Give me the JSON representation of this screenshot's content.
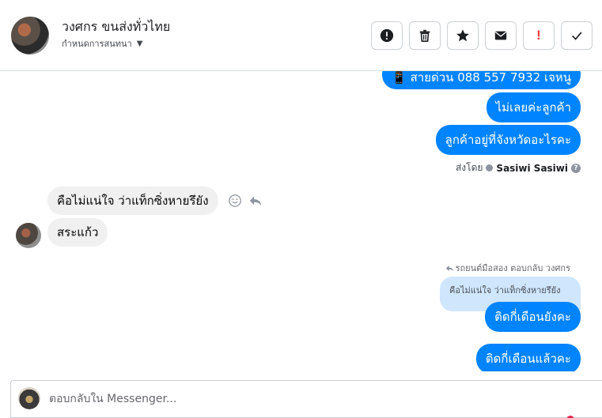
{
  "header": {
    "contact_name": "วงศกร ขนส่งทั่วไทย",
    "assign_label": "กำหนดการสนทนา",
    "toolbar": [
      {
        "name": "spam-alert",
        "icon": "exclamation-circle-icon"
      },
      {
        "name": "delete",
        "icon": "trash-icon"
      },
      {
        "name": "star",
        "icon": "star-icon"
      },
      {
        "name": "mark-unread",
        "icon": "envelope-icon"
      },
      {
        "name": "follow-up",
        "icon": "red-exclamation-icon",
        "label": "!"
      },
      {
        "name": "mark-done",
        "icon": "checkmark-icon"
      }
    ]
  },
  "messages": {
    "out_1": "📱 สายด่วน 088 557 7932 เจหนู",
    "out_2": "ไม่เลยค่ะลูกค้า",
    "out_3": "ลูกค้าอยู่ที่จังหวัดอะไรคะ",
    "sent_by_prefix": "ส่งโดย",
    "sent_by_name": "Sasiwi Sasiwi",
    "sent_by_help": "?",
    "in_1": "คือไม่แน่ใจ ว่าแท็กซิ่งหายรึยัง",
    "in_2": "สระแก้ว",
    "reply_note": "รถยนต์มือสอง ตอบกลับ วงศกร",
    "reply_quote": "คือไม่แน่ใจ ว่าแท็กซิ่งหายรึยัง",
    "out_4": "ติดกี่เดือนยังคะ",
    "out_5": "ติดกี่เดือนแล้วคะ"
  },
  "composer": {
    "placeholder": "ตอบกลับใน Messenger..."
  },
  "colors": {
    "outgoing_bubble": "#0084ff",
    "incoming_bubble": "#f0f0f0",
    "quote_bubble": "#cfe6fd",
    "alert_red": "#fa383e"
  }
}
